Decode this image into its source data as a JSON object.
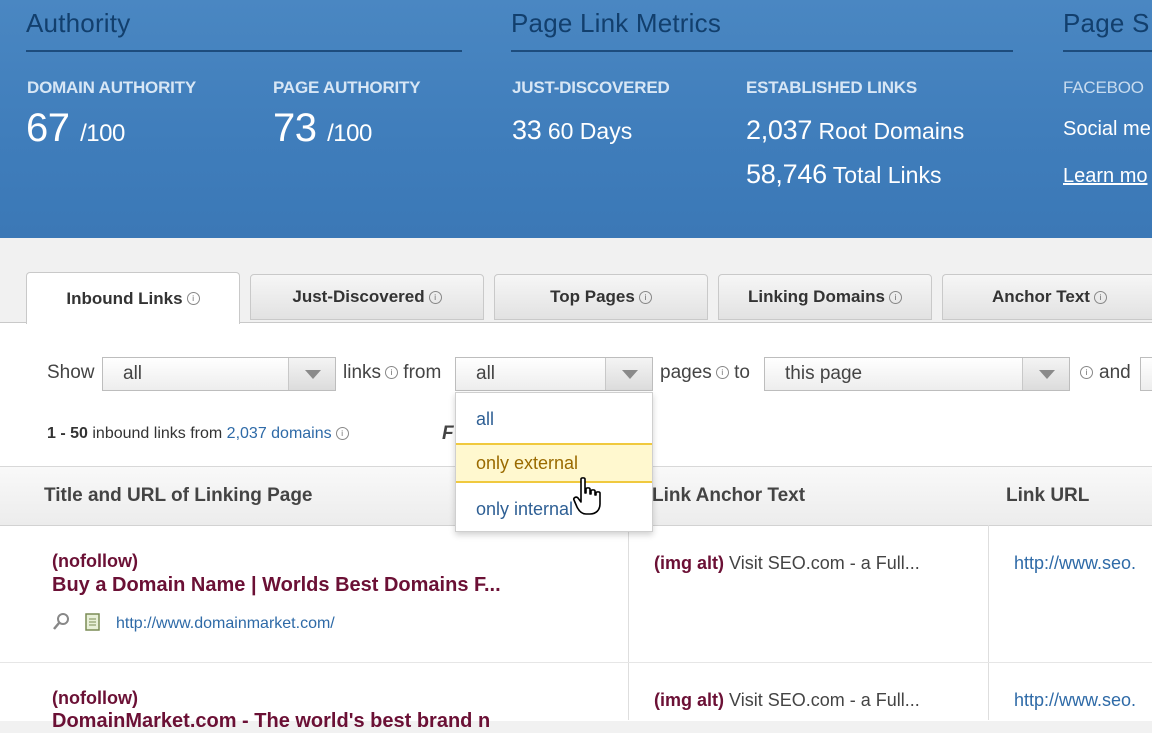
{
  "header": {
    "authority": {
      "title": "Authority",
      "domain_label": "DOMAIN AUTHORITY",
      "domain_value": "67",
      "domain_unit": "/100",
      "page_label": "PAGE AUTHORITY",
      "page_value": "73",
      "page_unit": "/100"
    },
    "page_link_metrics": {
      "title": "Page Link Metrics",
      "just_label": "JUST-DISCOVERED",
      "just_value": "33",
      "just_unit": "60 Days",
      "established_label": "ESTABLISHED LINKS",
      "root_value": "2,037",
      "root_unit": "Root Domains",
      "total_value": "58,746",
      "total_unit": "Total Links"
    },
    "page_social": {
      "title": "Page S",
      "label": "FACEBOO",
      "text": "Social me",
      "link": "Learn mo"
    }
  },
  "tabs": [
    {
      "label": "Inbound Links"
    },
    {
      "label": "Just-Discovered"
    },
    {
      "label": "Top Pages"
    },
    {
      "label": "Linking Domains"
    },
    {
      "label": "Anchor Text"
    }
  ],
  "filters": {
    "show_label": "Show",
    "show_value": "all",
    "links_label": "links",
    "from_label": "from",
    "from_value": "all",
    "pages_label": "pages",
    "to_label": "to",
    "to_value": "this page",
    "and_label": "and"
  },
  "dropdown": {
    "options": [
      "all",
      "only external",
      "only internal"
    ],
    "highlighted": "only external"
  },
  "summary": {
    "range": "1 - 50",
    "text": "inbound links from",
    "domains_link": "2,037 domains",
    "partial": "F"
  },
  "table": {
    "columns": [
      "Title and URL of Linking Page",
      "Link Anchor Text",
      "Link URL"
    ],
    "rows": [
      {
        "tag": "(nofollow)",
        "title": "Buy a Domain Name | Worlds Best Domains F...",
        "url": "http://www.domainmarket.com/",
        "anchor_type": "(img alt)",
        "anchor_text": "Visit SEO.com - a Full...",
        "link_url": "http://www.seo."
      },
      {
        "tag": "(nofollow)",
        "title": "DomainMarket.com - The world's best brand n",
        "url": "",
        "anchor_type": "(img alt)",
        "anchor_text": "Visit SEO.com - a Full...",
        "link_url": "http://www.seo."
      }
    ]
  }
}
